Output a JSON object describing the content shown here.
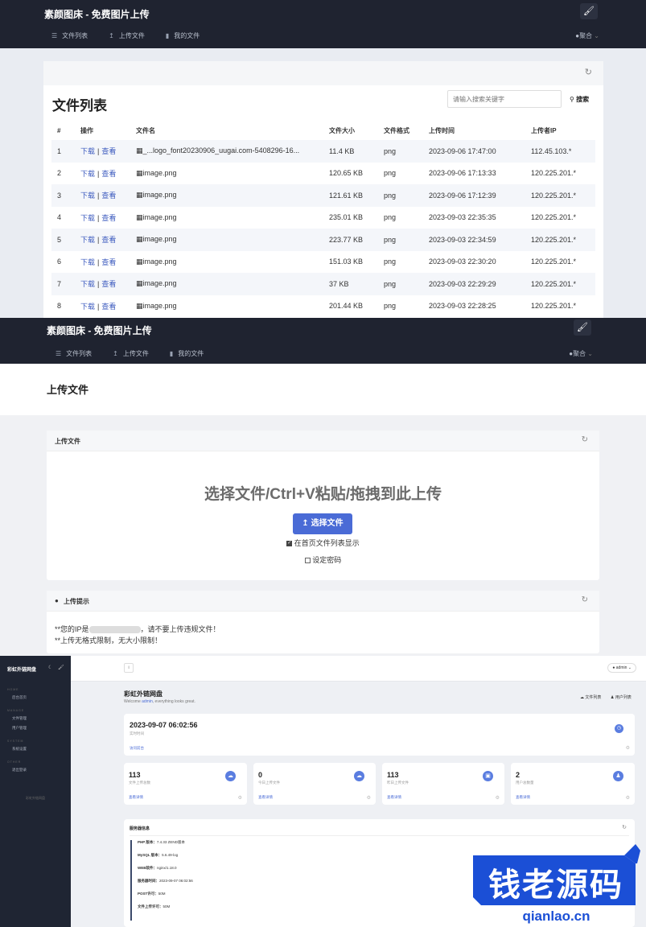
{
  "nav": {
    "brand": "素颜图床 - 免费图片上传",
    "menu": [
      "文件列表",
      "上传文件",
      "我的文件"
    ],
    "user": "聚合"
  },
  "filelist": {
    "title": "文件列表",
    "search_placeholder": "请输入搜索关键字",
    "search_button": "搜索",
    "headers": [
      "#",
      "操作",
      "文件名",
      "文件大小",
      "文件格式",
      "上传时间",
      "上传者IP"
    ],
    "download": "下载",
    "view": "查看",
    "rows": [
      {
        "n": "1",
        "name": "_...logo_font20230906_uugai.com-5408296-16...",
        "size": "11.4 KB",
        "fmt": "png",
        "time": "2023-09-06 17:47:00",
        "ip": "112.45.103.*"
      },
      {
        "n": "2",
        "name": "image.png",
        "size": "120.65 KB",
        "fmt": "png",
        "time": "2023-09-06 17:13:33",
        "ip": "120.225.201.*"
      },
      {
        "n": "3",
        "name": "image.png",
        "size": "121.61 KB",
        "fmt": "png",
        "time": "2023-09-06 17:12:39",
        "ip": "120.225.201.*"
      },
      {
        "n": "4",
        "name": "image.png",
        "size": "235.01 KB",
        "fmt": "png",
        "time": "2023-09-03 22:35:35",
        "ip": "120.225.201.*"
      },
      {
        "n": "5",
        "name": "image.png",
        "size": "223.77 KB",
        "fmt": "png",
        "time": "2023-09-03 22:34:59",
        "ip": "120.225.201.*"
      },
      {
        "n": "6",
        "name": "image.png",
        "size": "151.03 KB",
        "fmt": "png",
        "time": "2023-09-03 22:30:20",
        "ip": "120.225.201.*"
      },
      {
        "n": "7",
        "name": "image.png",
        "size": "37 KB",
        "fmt": "png",
        "time": "2023-09-03 22:29:29",
        "ip": "120.225.201.*"
      },
      {
        "n": "8",
        "name": "image.png",
        "size": "201.44 KB",
        "fmt": "png",
        "time": "2023-09-03 22:28:25",
        "ip": "120.225.201.*"
      }
    ]
  },
  "upload": {
    "page_title": "上传文件",
    "card_title": "上传文件",
    "drop_text": "选择文件/Ctrl+V粘贴/拖拽到此上传",
    "choose_button": "选择文件",
    "show_on_home": "在首页文件列表显示",
    "set_password": "设定密码",
    "tips_title": "上传提示",
    "tip1_pre": "**您的IP是",
    "tip1_post": "，请不要上传违规文件！",
    "tip2": "**上传无格式限制，无大小限制！"
  },
  "admin": {
    "brand": "彩虹外链网盘",
    "user": "admin",
    "sidebar": [
      {
        "type": "section",
        "label": "HOME"
      },
      {
        "type": "item",
        "label": "后台首页"
      },
      {
        "type": "section",
        "label": "MANAGE"
      },
      {
        "type": "item",
        "label": "文件管理"
      },
      {
        "type": "item",
        "label": "用户管理"
      },
      {
        "type": "section",
        "label": "SYSTEM"
      },
      {
        "type": "item",
        "label": "系统设置"
      },
      {
        "type": "section",
        "label": "OTHER"
      },
      {
        "type": "item",
        "label": "退出登录"
      }
    ],
    "sidebar_footer": "彩虹外链网盘",
    "title": "彩虹外链网盘",
    "welcome_pre": "Welcome ",
    "welcome_user": "admin",
    "welcome_post": ", everything looks great.",
    "link_files": "文件列表",
    "link_users": "用户列表",
    "datetime": "2023-09-07 06:02:56",
    "datetime_label": "实时时间",
    "datetime_link": "访问前台",
    "stats": [
      {
        "n": "113",
        "l": "文件上传总数",
        "v": "查看详情"
      },
      {
        "n": "0",
        "l": "今日上传文件",
        "v": "查看详情"
      },
      {
        "n": "113",
        "l": "昨日上传文件",
        "v": "查看详情"
      },
      {
        "n": "2",
        "l": "用户总数量",
        "v": "查看详情"
      }
    ],
    "server_title": "服务器信息",
    "server_info": [
      {
        "k": "PHP 版本：",
        "v": "7.4.33 ZEND版本"
      },
      {
        "k": "MySQL 版本：",
        "v": "5.6.49-log"
      },
      {
        "k": "WEB软件：",
        "v": "nginx/1.18.0"
      },
      {
        "k": "服务器时间：",
        "v": "2023-09-07 06:02:56"
      },
      {
        "k": "POST许可：",
        "v": "50M"
      },
      {
        "k": "文件上传许可：",
        "v": "50M"
      }
    ]
  },
  "watermark": {
    "text": "钱老源码",
    "domain": "qianlao.cn"
  },
  "colors": {
    "nav_bg": "#1f2330",
    "link": "#3d5bbf",
    "primary": "#4a6bd6",
    "sidebar": "#1f2533",
    "watermark_blue": "#1b4fd6"
  }
}
